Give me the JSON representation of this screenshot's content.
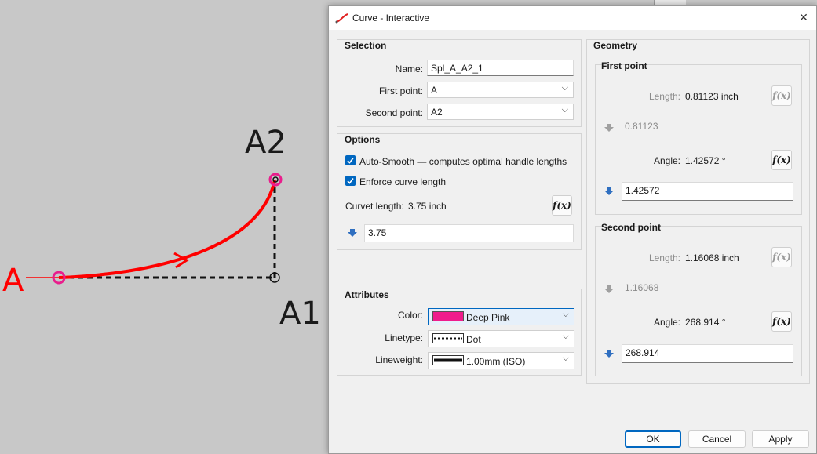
{
  "canvas": {
    "points": {
      "A": "A",
      "A1": "A1",
      "A2": "A2"
    },
    "curve_color": "#ff0000",
    "marker_color": "#e91e8c"
  },
  "dialog": {
    "title": "Curve - Interactive",
    "title_icon": "curve-icon",
    "selection": {
      "title": "Selection",
      "name_label": "Name:",
      "name_value": "Spl_A_A2_1",
      "first_point_label": "First point:",
      "first_point_value": "A",
      "second_point_label": "Second point:",
      "second_point_value": "A2"
    },
    "options": {
      "title": "Options",
      "auto_smooth_label": "Auto-Smooth — computes optimal handle lengths",
      "auto_smooth_checked": true,
      "enforce_length_label": "Enforce curve length",
      "enforce_length_checked": true,
      "curvet_length_label": "Curvet length:",
      "curvet_length_value": "3.75 inch",
      "length_input": "3.75"
    },
    "attributes": {
      "title": "Attributes",
      "color_label": "Color:",
      "color_value": "Deep Pink",
      "color_hex": "#ef1c8c",
      "linetype_label": "Linetype:",
      "linetype_value": "Dot",
      "lineweight_label": "Lineweight:",
      "lineweight_value": "1.00mm (ISO)"
    },
    "geometry": {
      "title": "Geometry",
      "first_point": {
        "title": "First point",
        "length_label": "Length:",
        "length_value": "0.81123 inch",
        "length_input": "0.81123",
        "angle_label": "Angle:",
        "angle_value": "1.42572 °",
        "angle_input": "1.42572"
      },
      "second_point": {
        "title": "Second point",
        "length_label": "Length:",
        "length_value": "1.16068 inch",
        "length_input": "1.16068",
        "angle_label": "Angle:",
        "angle_value": "268.914 °",
        "angle_input": "268.914"
      }
    },
    "fx_label": "f(x)",
    "buttons": {
      "ok": "OK",
      "cancel": "Cancel",
      "apply": "Apply"
    },
    "accent_color": "#0067c0"
  }
}
